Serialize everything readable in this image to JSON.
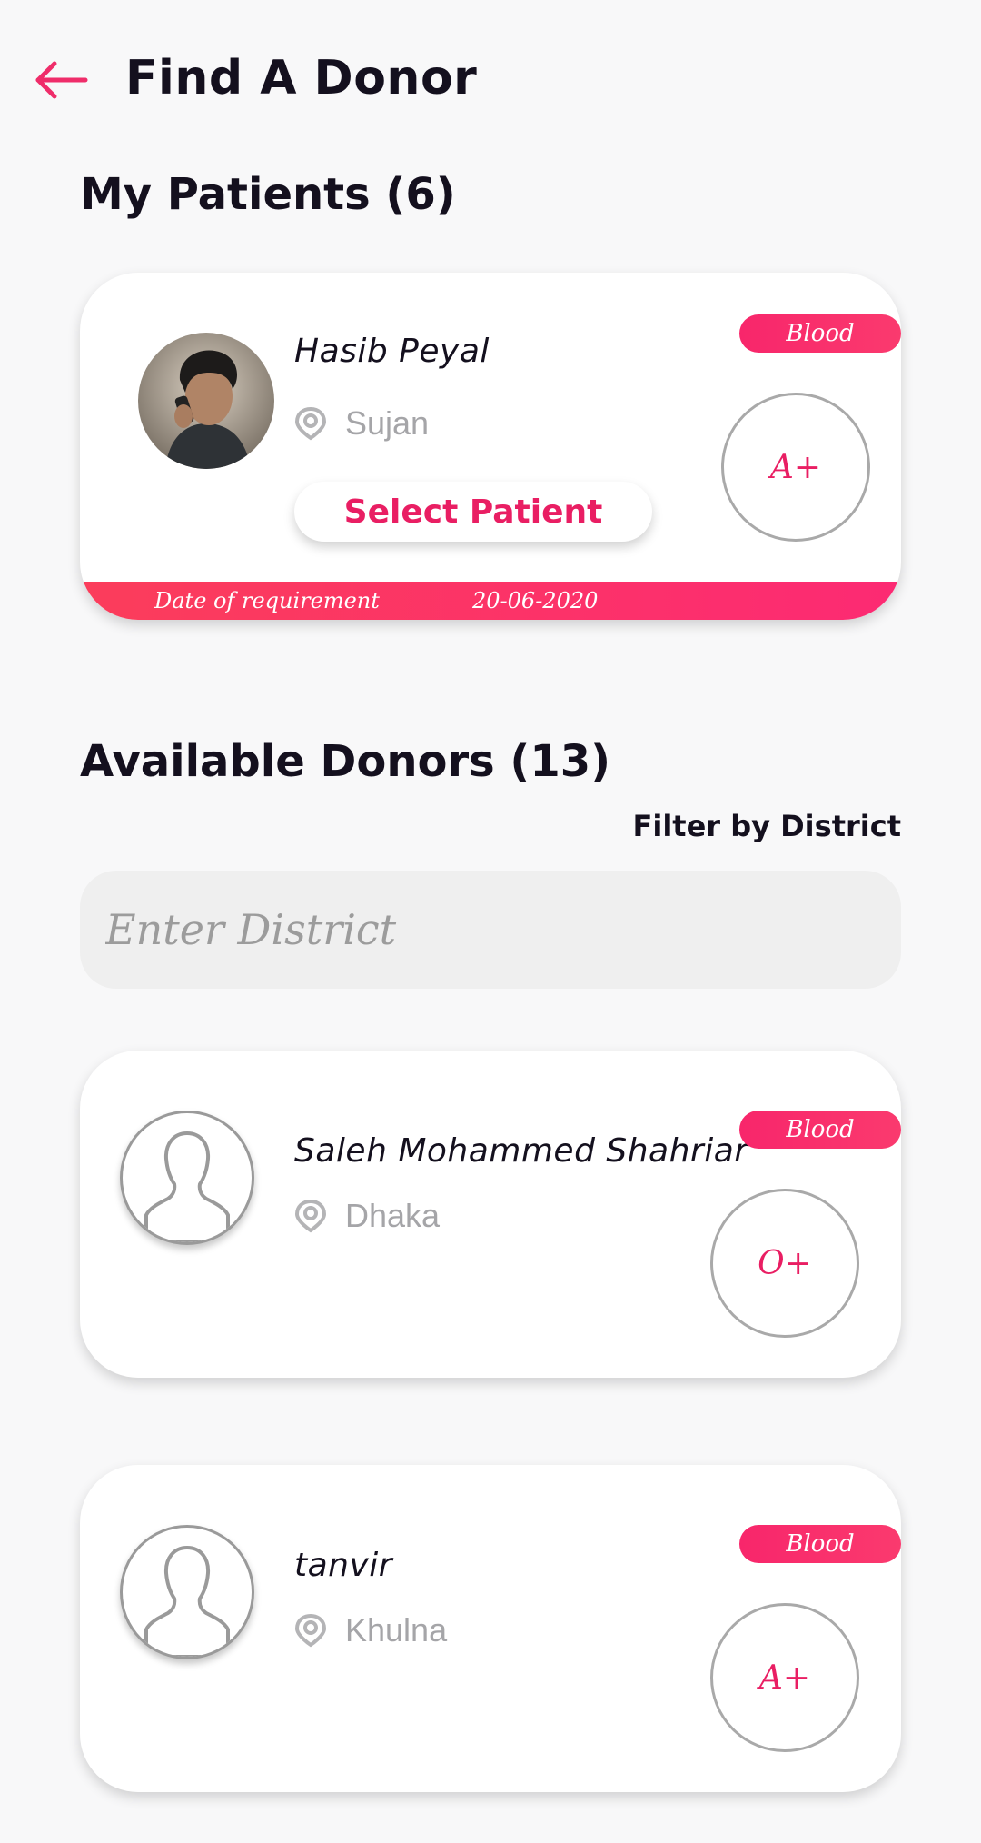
{
  "header": {
    "title": "Find A Donor",
    "back_icon": "arrow-left-icon",
    "accent_color": "#ef2d6a"
  },
  "patients": {
    "title": "My Patients",
    "count": "(6)",
    "items": [
      {
        "name": "Hasib Peyal",
        "location": "Sujan",
        "badge": "Blood",
        "blood_group": "A+",
        "select_label": "Select Patient",
        "date_label": "Date of requirement",
        "date_value": "20-06-2020"
      }
    ]
  },
  "donors": {
    "title": "Available Donors",
    "count": "(13)",
    "filter_label": "Filter by District",
    "district_placeholder": "Enter District",
    "items": [
      {
        "name": "Saleh Mohammed Shahriar",
        "location": "Dhaka",
        "badge": "Blood",
        "blood_group": "O+"
      },
      {
        "name": "tanvir",
        "location": "Khulna",
        "badge": "Blood",
        "blood_group": "A+"
      }
    ]
  },
  "colors": {
    "accent": "#e91e63",
    "badge_gradient_start": "#f8266b",
    "strip_gradient_start": "#fb3d5b",
    "background": "#f8f8f9"
  }
}
